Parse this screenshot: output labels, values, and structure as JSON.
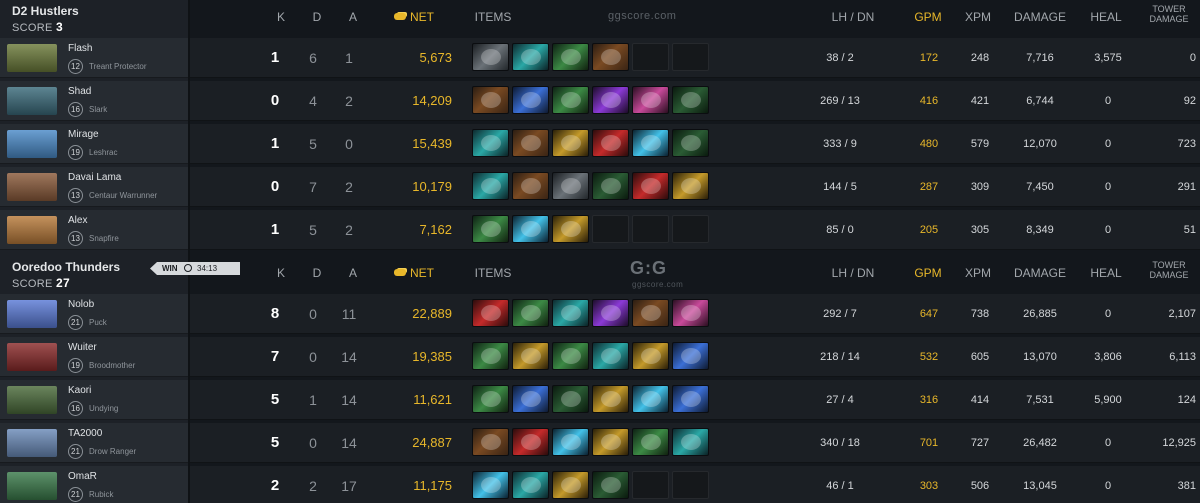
{
  "teams": [
    {
      "name": "D2 Hustlers",
      "score_label": "SCORE",
      "score": "3",
      "players": [
        {
          "name": "Flash",
          "level": "12",
          "hero": "Treant Protector",
          "portrait_color": "#6b7a3a",
          "k": "1",
          "d": "6",
          "a": "1",
          "net": "5,673",
          "items": [
            "ic-ring",
            "ic-teal",
            "ic-green",
            "ic-boots",
            "empty",
            "empty"
          ],
          "lh_dn": "38 / 2",
          "gpm": "172",
          "xpm": "248",
          "damage": "7,716",
          "heal": "3,575",
          "tower": "0"
        },
        {
          "name": "Shad",
          "level": "16",
          "hero": "Slark",
          "portrait_color": "#3a6a7a",
          "k": "0",
          "d": "4",
          "a": "2",
          "net": "14,209",
          "items": [
            "ic-boots",
            "ic-blue",
            "ic-green",
            "ic-purple",
            "ic-pink",
            "ic-darkgreen"
          ],
          "lh_dn": "269 / 13",
          "gpm": "416",
          "xpm": "421",
          "damage": "6,744",
          "heal": "0",
          "tower": "92"
        },
        {
          "name": "Mirage",
          "level": "19",
          "hero": "Leshrac",
          "portrait_color": "#4a8ac8",
          "k": "1",
          "d": "5",
          "a": "0",
          "net": "15,439",
          "items": [
            "ic-teal",
            "ic-boots",
            "ic-gold",
            "ic-red",
            "ic-cyan",
            "ic-darkgreen"
          ],
          "lh_dn": "333 / 9",
          "gpm": "480",
          "xpm": "579",
          "damage": "12,070",
          "heal": "0",
          "tower": "723"
        },
        {
          "name": "Davai Lama",
          "level": "13",
          "hero": "Centaur Warrunner",
          "portrait_color": "#8a5a3a",
          "k": "0",
          "d": "7",
          "a": "2",
          "net": "10,179",
          "items": [
            "ic-teal",
            "ic-boots",
            "ic-ring",
            "ic-darkgreen",
            "ic-red",
            "ic-gold"
          ],
          "lh_dn": "144 / 5",
          "gpm": "287",
          "xpm": "309",
          "damage": "7,450",
          "heal": "0",
          "tower": "291"
        },
        {
          "name": "Alex",
          "level": "13",
          "hero": "Snapfire",
          "portrait_color": "#b87a3a",
          "k": "1",
          "d": "5",
          "a": "2",
          "net": "7,162",
          "items": [
            "ic-green",
            "ic-cyan",
            "ic-gold",
            "empty",
            "empty",
            "empty"
          ],
          "lh_dn": "85 / 0",
          "gpm": "205",
          "xpm": "305",
          "damage": "8,349",
          "heal": "0",
          "tower": "51"
        }
      ]
    },
    {
      "name": "Ooredoo Thunders",
      "score_label": "SCORE",
      "score": "27",
      "players": [
        {
          "name": "Nolob",
          "level": "21",
          "hero": "Puck",
          "portrait_color": "#5a7ad6",
          "k": "8",
          "d": "0",
          "a": "11",
          "net": "22,889",
          "items": [
            "ic-red",
            "ic-green",
            "ic-teal",
            "ic-purple",
            "ic-boots",
            "ic-pink"
          ],
          "lh_dn": "292 / 7",
          "gpm": "647",
          "xpm": "738",
          "damage": "26,885",
          "heal": "0",
          "tower": "2,107"
        },
        {
          "name": "Wuiter",
          "level": "19",
          "hero": "Broodmother",
          "portrait_color": "#8a2a2a",
          "k": "7",
          "d": "0",
          "a": "14",
          "net": "19,385",
          "items": [
            "ic-green",
            "ic-gold",
            "ic-green",
            "ic-teal",
            "ic-gold",
            "ic-blue"
          ],
          "lh_dn": "218 / 14",
          "gpm": "532",
          "xpm": "605",
          "damage": "13,070",
          "heal": "3,806",
          "tower": "6,113"
        },
        {
          "name": "Kaori",
          "level": "16",
          "hero": "Undying",
          "portrait_color": "#4a6a3a",
          "k": "5",
          "d": "1",
          "a": "14",
          "net": "11,621",
          "items": [
            "ic-green",
            "ic-blue",
            "ic-darkgreen",
            "ic-gold",
            "ic-cyan",
            "ic-blue"
          ],
          "lh_dn": "27 / 4",
          "gpm": "316",
          "xpm": "414",
          "damage": "7,531",
          "heal": "5,900",
          "tower": "124"
        },
        {
          "name": "TA2000",
          "level": "21",
          "hero": "Drow Ranger",
          "portrait_color": "#6a8ab8",
          "k": "5",
          "d": "0",
          "a": "14",
          "net": "24,887",
          "items": [
            "ic-boots",
            "ic-red",
            "ic-cyan",
            "ic-gold",
            "ic-green",
            "ic-teal"
          ],
          "lh_dn": "340 / 18",
          "gpm": "701",
          "xpm": "727",
          "damage": "26,482",
          "heal": "0",
          "tower": "12,925"
        },
        {
          "name": "OmaR",
          "level": "21",
          "hero": "Rubick",
          "portrait_color": "#3a7a4a",
          "k": "2",
          "d": "2",
          "a": "17",
          "net": "11,175",
          "items": [
            "ic-cyan",
            "ic-teal",
            "ic-gold",
            "ic-darkgreen",
            "empty",
            "empty"
          ],
          "lh_dn": "46 / 1",
          "gpm": "303",
          "xpm": "506",
          "damage": "13,045",
          "heal": "0",
          "tower": "381"
        }
      ]
    }
  ],
  "headers": {
    "k": "K",
    "d": "D",
    "a": "A",
    "net": "NET",
    "items": "ITEMS",
    "lh_dn": "LH / DN",
    "gpm": "GPM",
    "xpm": "XPM",
    "damage": "DAMAGE",
    "heal": "HEAL",
    "tower_line1": "TOWER",
    "tower_line2": "DAMAGE"
  },
  "win_badge": {
    "label": "WIN",
    "duration": "34:13"
  },
  "watermark": {
    "top": "ggscore.com",
    "logo": "G:G",
    "sub": "ggscore.com"
  },
  "colors": {
    "gold": "#e8b72a",
    "background": "#13171c"
  }
}
